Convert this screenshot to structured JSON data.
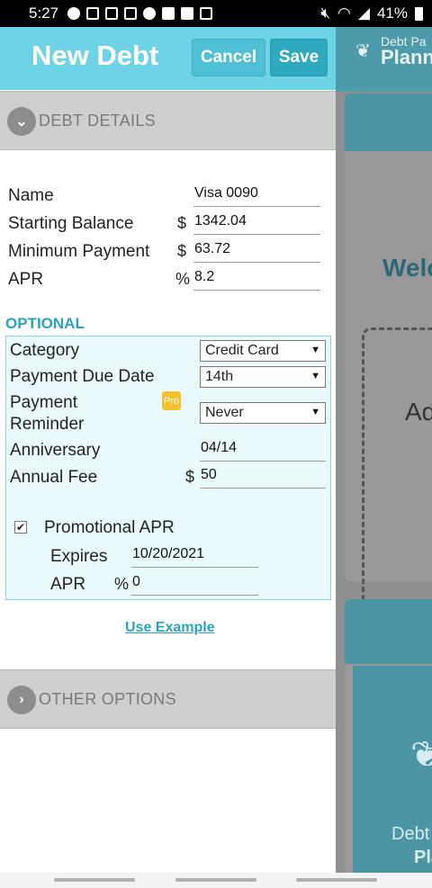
{
  "status_bar": {
    "time": "5:27",
    "battery": "41%",
    "left_icons": [
      "alarm-icon",
      "gmail-icon",
      "twitch-icon",
      "twitch-icon",
      "cloud-icon",
      "photos-icon",
      "bag-icon",
      "box-icon"
    ],
    "right_icons": [
      "mute-icon",
      "wifi-icon",
      "signal-icon",
      "battery-icon"
    ]
  },
  "background_app": {
    "logo_small": "Debt Pa",
    "logo_big": "Plann",
    "welcome": "Welc",
    "card_text": "Ad",
    "panel_debt": "Debt",
    "panel_pla": "Pla"
  },
  "dialog": {
    "title": "New Debt",
    "cancel_label": "Cancel",
    "save_label": "Save",
    "debt_details_header": "DEBT DETAILS",
    "other_options_header": "OTHER OPTIONS",
    "use_example_label": "Use Example"
  },
  "fields": {
    "name": {
      "label": "Name",
      "value": "Visa 0090"
    },
    "starting_balance": {
      "label": "Starting Balance",
      "unit": "$",
      "value": "1342.04"
    },
    "minimum_payment": {
      "label": "Minimum Payment",
      "unit": "$",
      "value": "63.72"
    },
    "apr": {
      "label": "APR",
      "unit": "%",
      "value": "8.2"
    }
  },
  "optional": {
    "title": "OPTIONAL",
    "category": {
      "label": "Category",
      "value": "Credit Card"
    },
    "payment_due_date": {
      "label": "Payment Due Date",
      "value": "14th"
    },
    "payment_reminder": {
      "label_line1": "Payment",
      "label_line2": "Reminder",
      "badge": "Pro",
      "value": "Never"
    },
    "anniversary": {
      "label": "Anniversary",
      "value": "04/14"
    },
    "annual_fee": {
      "label": "Annual Fee",
      "unit": "$",
      "value": "50"
    },
    "promotional_apr": {
      "label": "Promotional APR",
      "checked": true,
      "expires_label": "Expires",
      "expires_value": "10/20/2021",
      "apr_label": "APR",
      "apr_unit": "%",
      "apr_value": "0"
    }
  },
  "colors": {
    "header_bg": "#6fd3e6",
    "accent": "#2aa3ba",
    "pro_badge": "#f3c12e",
    "optional_bg": "#eafafc"
  }
}
